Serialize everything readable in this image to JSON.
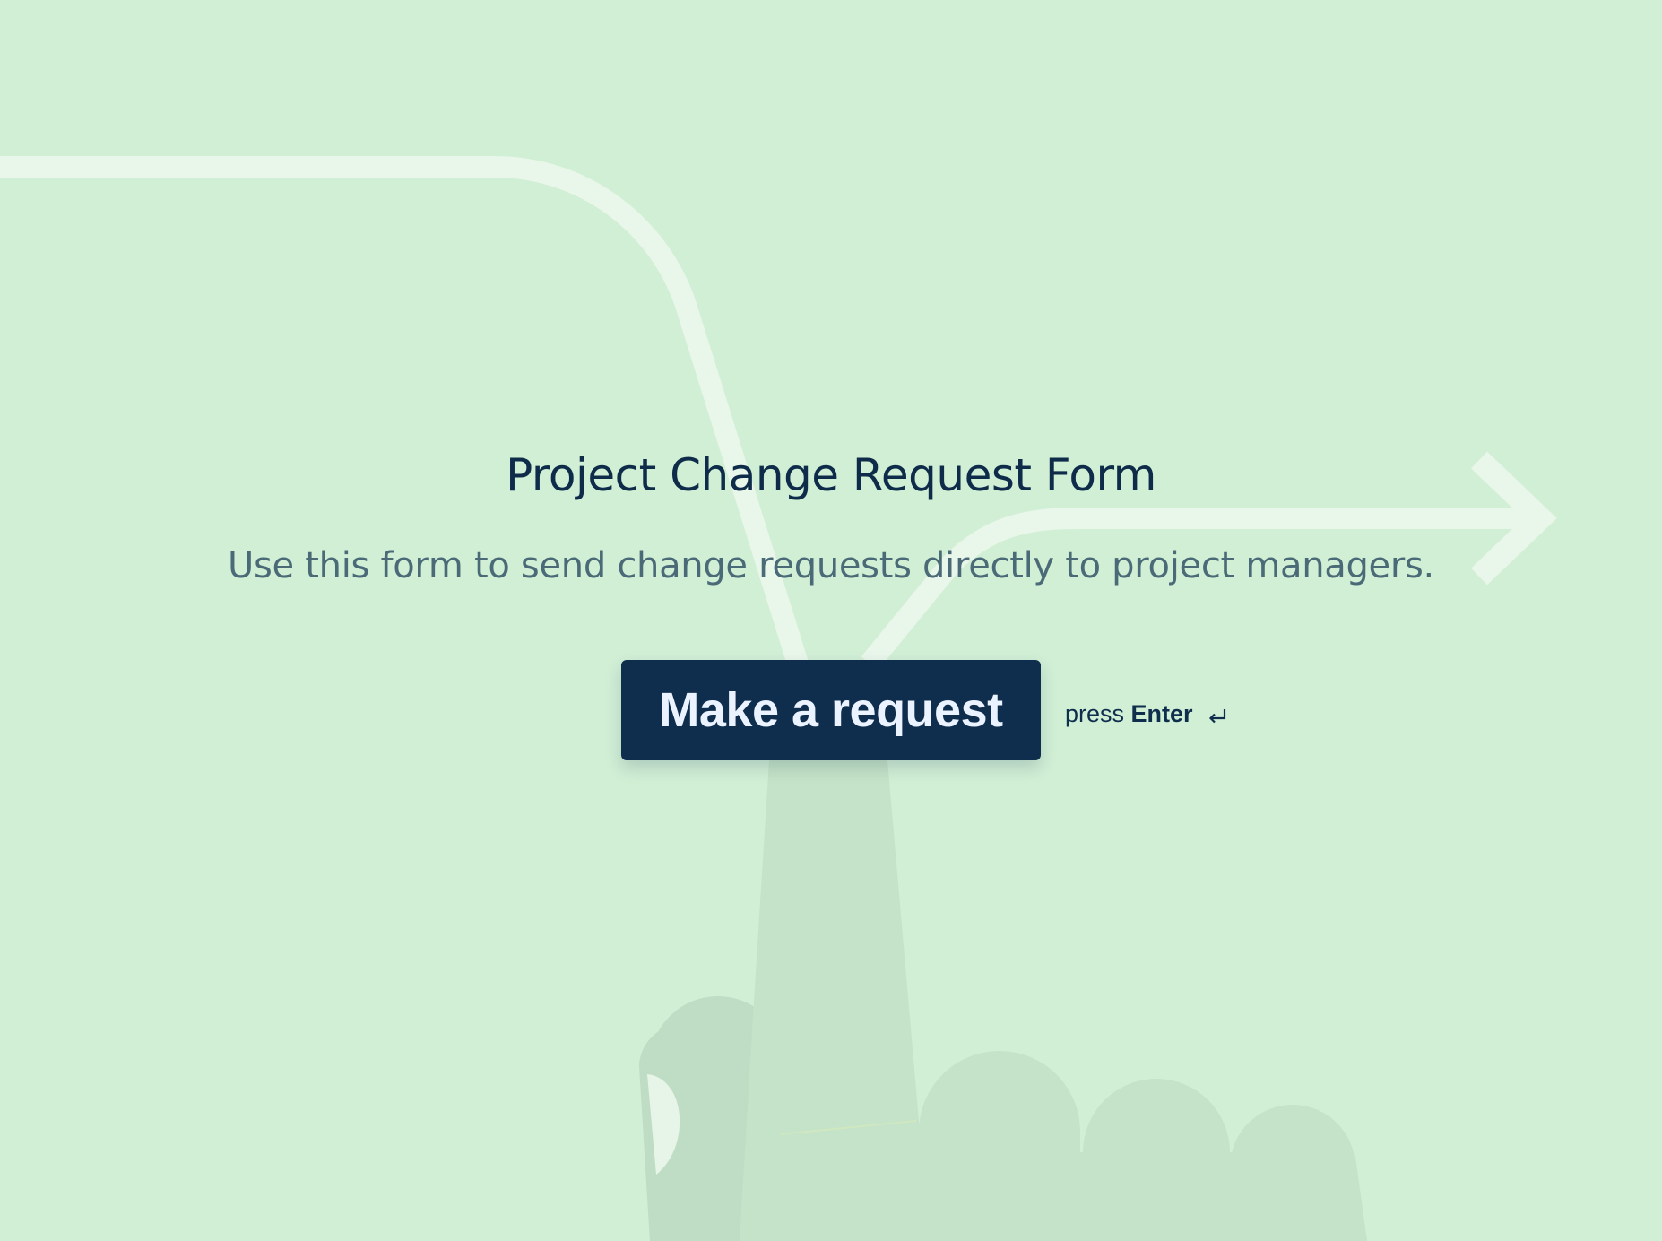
{
  "page": {
    "title": "Project Change Request Form",
    "subtitle": "Use this form to send change requests directly to project managers."
  },
  "cta": {
    "button_label": "Make a request",
    "hint_prefix": "press",
    "hint_key": "Enter",
    "hint_icon": "enter-return-icon"
  },
  "colors": {
    "background": "#d1efd5",
    "primary": "#0f2d4c",
    "title_text": "#0e2b4a",
    "subtitle_text": "#4b6a77",
    "button_text": "#eaf3ff"
  }
}
